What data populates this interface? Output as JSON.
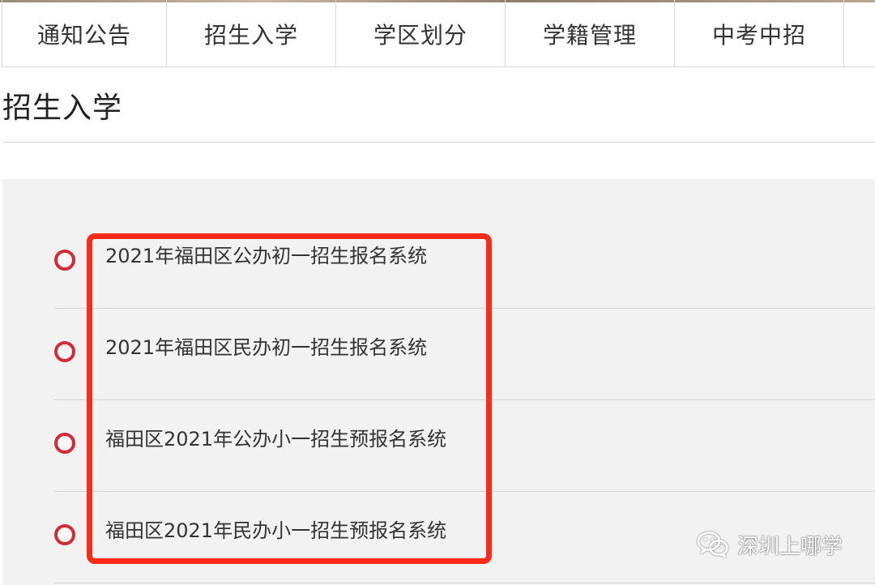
{
  "nav": {
    "tabs": [
      {
        "label": "通知公告"
      },
      {
        "label": "招生入学"
      },
      {
        "label": "学区划分"
      },
      {
        "label": "学籍管理"
      },
      {
        "label": "中考中招"
      }
    ]
  },
  "page": {
    "title": "招生入学"
  },
  "list": {
    "items": [
      {
        "label": "2021年福田区公办初一招生报名系统"
      },
      {
        "label": "2021年福田区民办初一招生报名系统"
      },
      {
        "label": "福田区2021年公办小一招生预报名系统"
      },
      {
        "label": "福田区2021年民办小一招生预报名系统"
      }
    ]
  },
  "watermark": {
    "text": "深圳上哪学",
    "icon": "wechat-icon"
  },
  "colors": {
    "bullet": "#d22b3a",
    "highlight": "#ff2a1a",
    "panel_bg": "#f2f2f2"
  }
}
